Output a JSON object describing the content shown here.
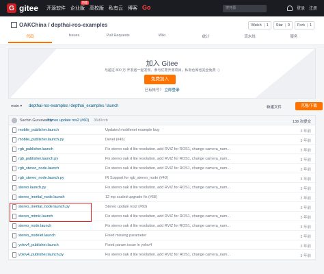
{
  "nav": {
    "logo_mark": "G",
    "logo_text": "gitee",
    "items": [
      "开源软件",
      "企业版",
      "高校版",
      "私有云",
      "博客"
    ],
    "badge": "特惠",
    "go": "Go",
    "search_placeholder": "搜开源",
    "login": "登录",
    "register": "注册"
  },
  "repo": {
    "name": "OAKChina / depthai-ros-examples",
    "watch_label": "Watch",
    "watch_count": "1",
    "star_label": "Star",
    "star_count": "0",
    "fork_label": "Fork",
    "fork_count": "1",
    "tabs": [
      "代码",
      "Issues",
      "Pull Requests",
      "Wiki",
      "统计",
      "流水线",
      "服务"
    ]
  },
  "banner": {
    "title": "加入 Gitee",
    "subtitle": "与超过 800 万 开发者一起发现、参与优秀开源项目，私有仓库也完全免费 ：)",
    "join_button": "免费加入",
    "login_prefix": "已有帐号？",
    "login_link": "立即登录"
  },
  "path": {
    "branch": "main",
    "crumbs": [
      "depthai-ros-examples",
      "depthai_examples",
      "launch"
    ],
    "new_file": "新建文件",
    "clone_button": "克隆/下载"
  },
  "commit": {
    "author": "Sachin Guruswamy",
    "message": "Stereo update ros2 (#60)",
    "hash": "36d0ccb",
    "count": "138 次提交"
  },
  "files": [
    {
      "name": "mobile_publisher.launch",
      "msg": "Updated mobilenet example bug",
      "time": "3 年前"
    },
    {
      "name": "mobile_publisher.launch.py",
      "msg": "Devel (#45)",
      "time": "3 年前"
    },
    {
      "name": "rgb_publisher.launch",
      "msg": "Fix stereo oak d lite resolution, add RVIZ for ROS1, change camera_nam...",
      "time": "3 年前"
    },
    {
      "name": "rgb_publisher.launch.py",
      "msg": "Fix stereo oak d lite resolution, add RVIZ for ROS1, change camera_nam...",
      "time": "3 年前"
    },
    {
      "name": "rgb_stereo_node.launch",
      "msg": "Fix stereo oak d lite resolution, add RVIZ for ROS1, change camera_nam...",
      "time": "3 年前"
    },
    {
      "name": "rgb_stereo_node.launch.py",
      "msg": "IR Support for rgb_stereo_node (#40)",
      "time": "3 年前"
    },
    {
      "name": "stereo.launch.py",
      "msg": "Fix stereo oak d lite resolution, add RVIZ for ROS1, change camera_nam...",
      "time": "3 年前"
    },
    {
      "name": "stereo_inertial_node.launch",
      "msg": "12 mp scaled upgrade fix (#58)",
      "time": "3 年前"
    },
    {
      "name": "stereo_inertial_node.launch.py",
      "msg": "Stereo update ros2 (#60)",
      "time": "3 年前"
    },
    {
      "name": "stereo_mimic.launch",
      "msg": "Fix stereo oak d lite resolution, add RVIZ for ROS1, change camera_nam...",
      "time": "3 年前"
    },
    {
      "name": "stereo_node.launch",
      "msg": "Fix stereo oak d lite resolution, add RVIZ for ROS1, change camera_nam...",
      "time": "3 年前"
    },
    {
      "name": "stereo_nodelet.launch",
      "msg": "Fixed missing parameter",
      "time": "3 年前"
    },
    {
      "name": "yolov4_publisher.launch",
      "msg": "Fixed param issue in yolov4",
      "time": "3 年前"
    },
    {
      "name": "yolov4_publisher.launch.py",
      "msg": "Fix stereo oak d lite resolution, add RVIZ for ROS1, change camera_nam...",
      "time": "3 年前"
    }
  ],
  "colors": {
    "accent": "#fe7300",
    "brand": "#c71d23",
    "link": "#005980",
    "highlight_box": "#e02020"
  }
}
